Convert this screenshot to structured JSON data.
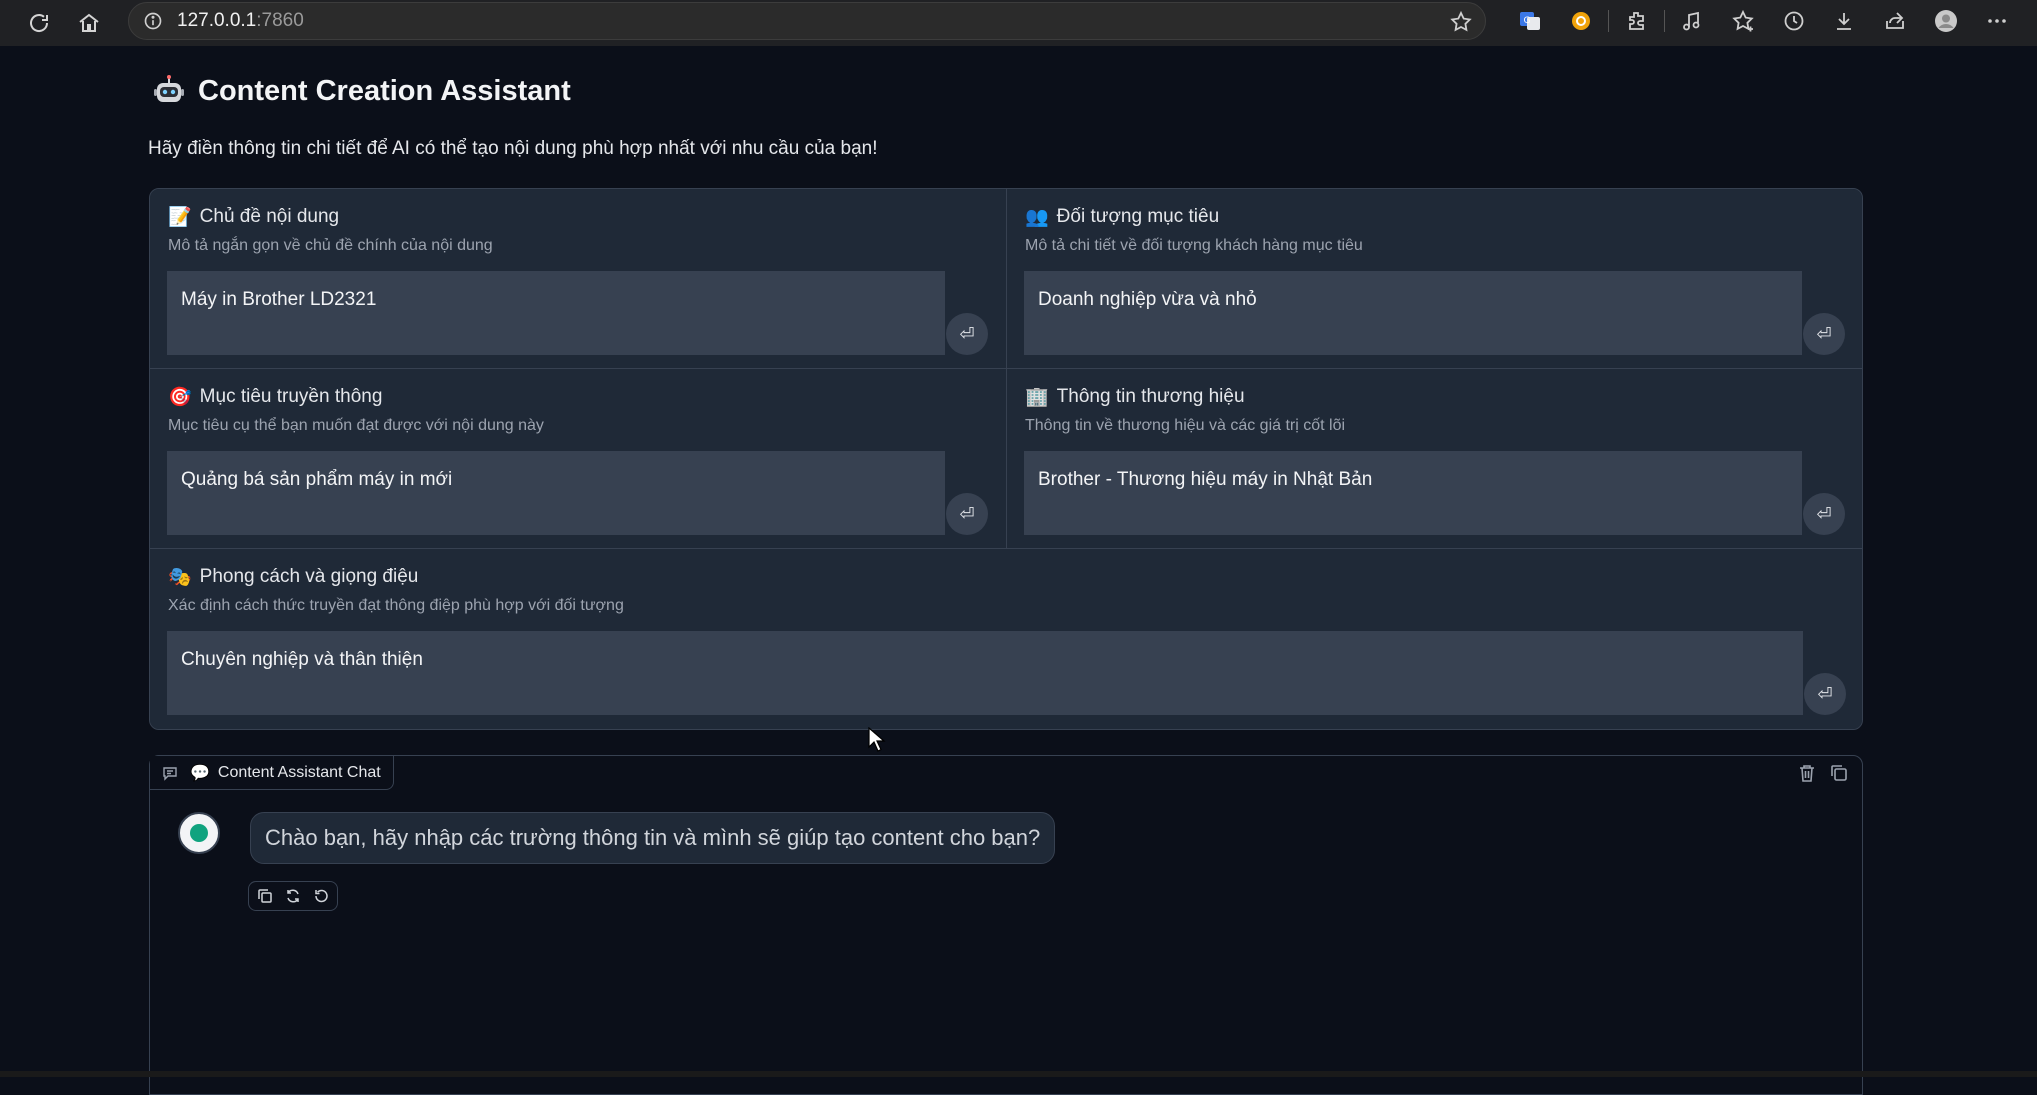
{
  "browser": {
    "url_host": "127.0.0.1",
    "url_port": ":7860",
    "toolbar_icons": [
      "translate-icon",
      "coin-extension-icon",
      "extensions-icon",
      "media-icon",
      "favorites-icon",
      "history-icon",
      "downloads-icon",
      "share-icon",
      "profile-icon",
      "more-icon"
    ]
  },
  "app": {
    "title": "Content Creation Assistant",
    "subtitle": "Hãy điền thông tin chi tiết để AI có thể tạo nội dung phù hợp nhất với nhu cầu của bạn!"
  },
  "fields": {
    "topic": {
      "emoji": "📝",
      "label": "Chủ đề nội dung",
      "info": "Mô tả ngắn gọn về chủ đề chính của nội dung",
      "value": "Máy in Brother LD2321"
    },
    "audience": {
      "emoji": "👥",
      "label": "Đối tượng mục tiêu",
      "info": "Mô tả chi tiết về đối tượng khách hàng mục tiêu",
      "value": "Doanh nghiệp vừa và nhỏ"
    },
    "goal": {
      "emoji": "🎯",
      "label": "Mục tiêu truyền thông",
      "info": "Mục tiêu cụ thể bạn muốn đạt được với nội dung này",
      "value": "Quảng bá sản phẩm máy in mới"
    },
    "brand": {
      "emoji": "🏢",
      "label": "Thông tin thương hiệu",
      "info": "Thông tin về thương hiệu và các giá trị cốt lõi",
      "value": "Brother - Thương hiệu máy in Nhật Bản"
    },
    "tone": {
      "emoji": "🎭",
      "label": "Phong cách và giọng điệu",
      "info": "Xác định cách thức truyền đạt thông điệp phù hợp với đối tượng",
      "value": "Chuyên nghiệp và thân thiện"
    },
    "submit_glyph": "⏎"
  },
  "chat": {
    "label_emoji": "💬",
    "label": "Content Assistant Chat",
    "messages": [
      {
        "role": "assistant",
        "text": "Chào bạn, hãy nhập các trường thông tin và mình sẽ giúp tạo content cho bạn?"
      }
    ]
  }
}
